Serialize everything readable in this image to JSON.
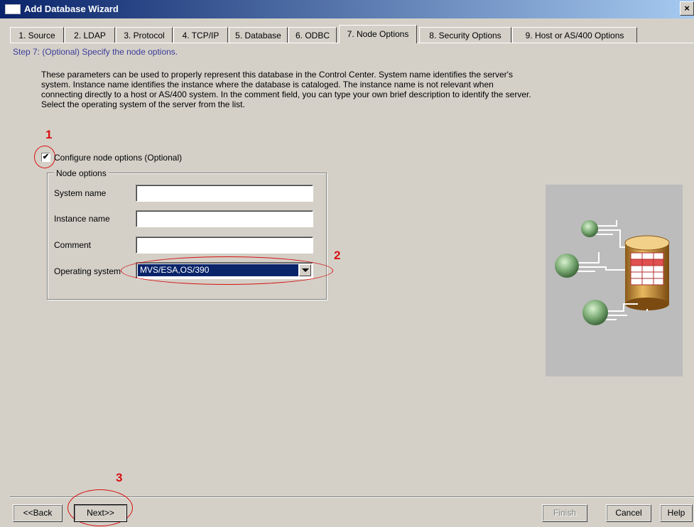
{
  "window": {
    "title": "Add Database Wizard",
    "close_glyph": "×"
  },
  "tabs": [
    {
      "label": "1. Source"
    },
    {
      "label": "2. LDAP"
    },
    {
      "label": "3. Protocol"
    },
    {
      "label": "4. TCP/IP"
    },
    {
      "label": "5. Database"
    },
    {
      "label": "6. ODBC"
    },
    {
      "label": "7. Node Options",
      "active": true
    },
    {
      "label": "8. Security Options"
    },
    {
      "label": "9. Host or AS/400 Options"
    }
  ],
  "step": {
    "title": "Step 7: (Optional) Specify the node options.",
    "description": "These parameters can be used to properly represent this database in the Control Center.  System name identifies the server's system.  Instance name identifies the instance where the database is cataloged.  The instance name is not relevant when connecting directly to a host or AS/400 system.  In the comment field, you can type your own brief description to identify the server.  Select the operating system of the server from the list."
  },
  "configure": {
    "label": "Configure node options (Optional)",
    "checked": true,
    "check_glyph": "✔"
  },
  "node_options": {
    "group_label": "Node options",
    "system_name_label": "System name",
    "system_name_value": "",
    "instance_name_label": "Instance name",
    "instance_name_value": "",
    "comment_label": "Comment",
    "comment_value": "",
    "os_label": "Operating system",
    "os_value": "MVS/ESA,OS/390"
  },
  "annotations": {
    "one": "1",
    "two": "2",
    "three": "3",
    "color": "#d81010"
  },
  "buttons": {
    "back": "<<Back",
    "next": "Next>>",
    "finish": "Finish",
    "cancel": "Cancel",
    "help": "Help"
  },
  "colors": {
    "titlebar": "#0a246a",
    "face": "#d4d0c8",
    "selection": "#0a246a",
    "step_text": "#3c3c9a"
  },
  "icons": {
    "illustration": "database-servers-illustration"
  }
}
